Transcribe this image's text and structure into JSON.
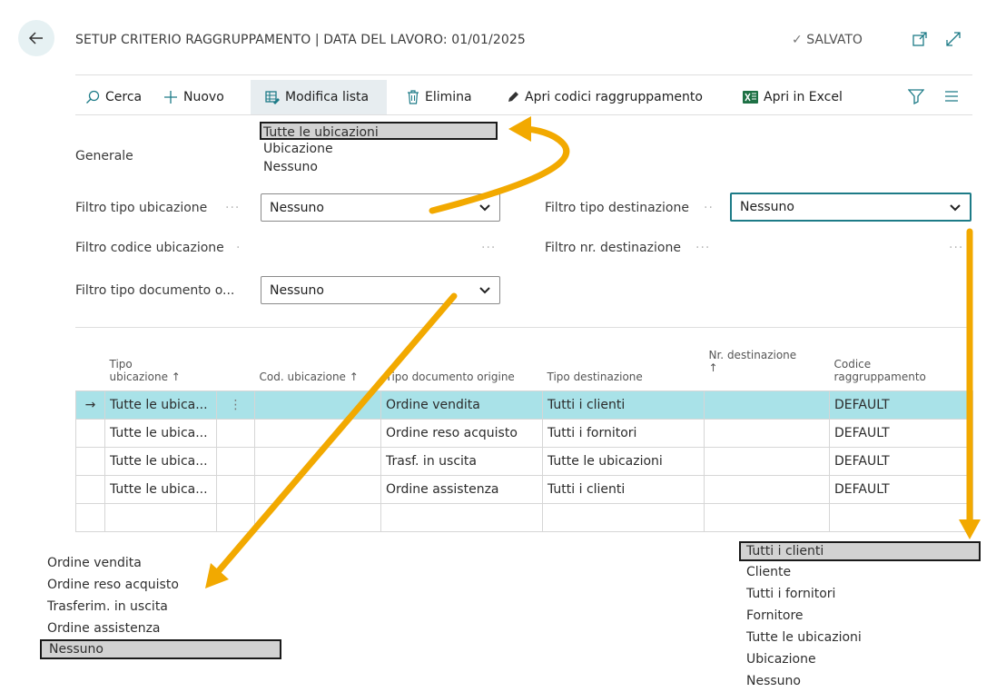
{
  "header": {
    "title": "SETUP CRITERIO RAGGRUPPAMENTO | DATA DEL LAVORO: 01/01/2025",
    "saved": "SALVATO"
  },
  "toolbar": {
    "search": "Cerca",
    "new": "Nuovo",
    "edit_list": "Modifica lista",
    "delete": "Elimina",
    "open_codes": "Apri codici raggruppamento",
    "open_excel": "Apri in Excel"
  },
  "general": {
    "section_label": "Generale",
    "location_type_filter": {
      "label": "Filtro tipo ubicazione",
      "value": "Nessuno"
    },
    "location_code_filter": {
      "label": "Filtro codice ubicazione"
    },
    "source_doc_type_filter": {
      "label": "Filtro tipo documento o...",
      "value": "Nessuno"
    },
    "destination_type_filter": {
      "label": "Filtro tipo destinazione",
      "value": "Nessuno"
    },
    "destination_no_filter": {
      "label": "Filtro nr. destinazione"
    }
  },
  "location_type_options": [
    "Tutte le ubicazioni",
    "Ubicazione",
    "Nessuno"
  ],
  "grid": {
    "headers": {
      "location_type_1": "Tipo",
      "location_type_2": "ubicazione ↑",
      "location_code": "Cod. ubicazione ↑",
      "source_doc_type": "Tipo documento origine",
      "destination_type": "Tipo destinazione",
      "destination_no_1": "Nr. destinazione",
      "destination_no_2": "↑",
      "group_code_1": "Codice",
      "group_code_2": "raggruppamento"
    },
    "rows": [
      {
        "location_type": "Tutte le ubica...",
        "location_code": "",
        "source_doc_type": "Ordine vendita",
        "destination_type": "Tutti i clienti",
        "destination_no": "",
        "group_code": "DEFAULT"
      },
      {
        "location_type": "Tutte le ubica...",
        "location_code": "",
        "source_doc_type": "Ordine reso acquisto",
        "destination_type": "Tutti i fornitori",
        "destination_no": "",
        "group_code": "DEFAULT"
      },
      {
        "location_type": "Tutte le ubica...",
        "location_code": "",
        "source_doc_type": "Trasf. in uscita",
        "destination_type": "Tutte le ubicazioni",
        "destination_no": "",
        "group_code": "DEFAULT"
      },
      {
        "location_type": "Tutte le ubica...",
        "location_code": "",
        "source_doc_type": "Ordine assistenza",
        "destination_type": "Tutti i clienti",
        "destination_no": "",
        "group_code": "DEFAULT"
      }
    ]
  },
  "source_doc_options": [
    "Ordine vendita",
    "Ordine reso acquisto",
    "Trasferim. in uscita",
    "Ordine assistenza",
    "Nessuno"
  ],
  "destination_type_options": [
    "Tutti i clienti",
    "Cliente",
    "Tutti i fornitori",
    "Fornitore",
    "Tutte le ubicazioni",
    "Ubicazione",
    "Nessuno"
  ],
  "colors": {
    "accent": "#1d7b87",
    "arrow": "#f2a900",
    "selected_row": "#a9e2e8"
  }
}
